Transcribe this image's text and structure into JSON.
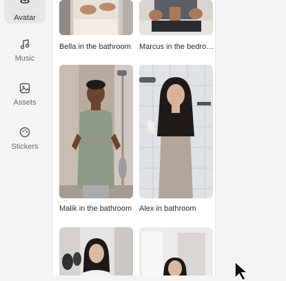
{
  "sidebar": {
    "items": [
      {
        "label": "Avatar",
        "icon": "avatar-icon"
      },
      {
        "label": "Music",
        "icon": "music-note-icon"
      },
      {
        "label": "Assets",
        "icon": "image-icon"
      },
      {
        "label": "Stickers",
        "icon": "sticker-icon"
      }
    ]
  },
  "avatars": [
    {
      "caption": "Bella in the bathroom"
    },
    {
      "caption": "Marcus in the bedro…"
    },
    {
      "caption": "Malik in the bathroom"
    },
    {
      "caption": "Alex in bathroom"
    }
  ],
  "colors": {
    "accent": "#2e2e33",
    "panel": "#ffffff",
    "sidebar": "#f4f4f5"
  }
}
